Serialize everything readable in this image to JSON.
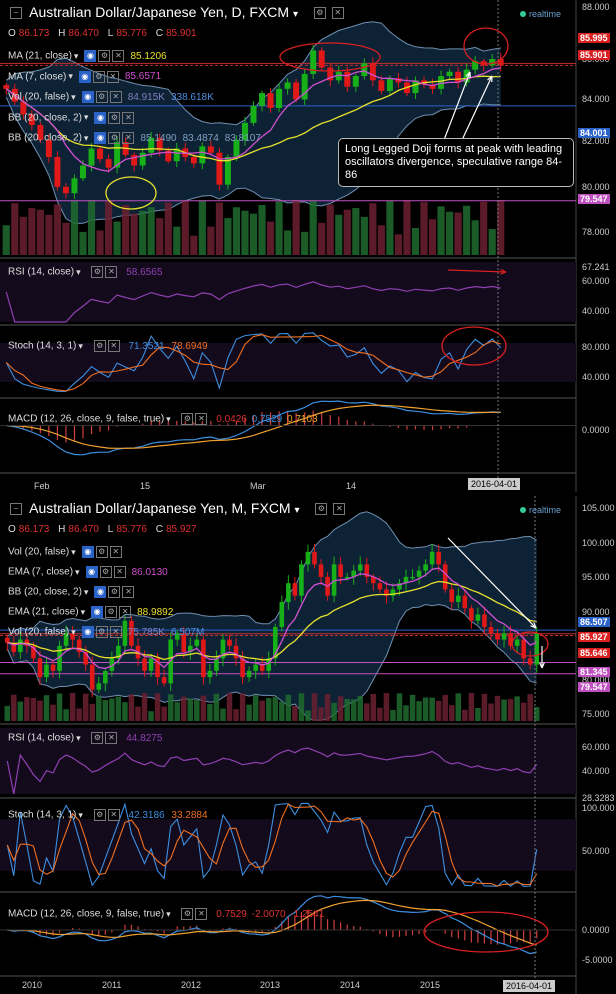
{
  "top": {
    "title": "Australian Dollar/Japanese Yen, D, FXCM",
    "realtime": "realtime",
    "ohlc": {
      "o": "86.173",
      "h": "86.470",
      "l": "85.776",
      "c": "85.901"
    },
    "indicators": [
      {
        "label": "MA (21, close)",
        "values": [
          "85.1206"
        ],
        "colors": [
          "#e8e02c"
        ]
      },
      {
        "label": "MA (7, close)",
        "values": [
          "85.6571"
        ],
        "colors": [
          "#d050d0"
        ]
      },
      {
        "label": "Vol (20, false)",
        "values": [
          "84.915K",
          "338.618K"
        ],
        "colors": [
          "#8080c0",
          "#4f8fe0"
        ]
      },
      {
        "label": "BB (20, close, 2)",
        "values": [],
        "colors": []
      },
      {
        "label": "BB (20, close, 2)",
        "values": [
          "85.1490",
          "83.4874",
          "83.8107"
        ],
        "colors": [
          "#7fa0c0",
          "#7fa0c0",
          "#7fa0c0"
        ]
      }
    ],
    "price_axis": [
      "88.000",
      "86.000",
      "84.000",
      "82.000",
      "80.000",
      "78.000"
    ],
    "tags": [
      {
        "text": "85.995",
        "color": "#d82020"
      },
      {
        "text": "85.901",
        "color": "#d82020"
      },
      {
        "text": "84.001",
        "color": "#2a62c8"
      },
      {
        "text": "79.547",
        "color": "#c050c0"
      }
    ],
    "annotation": "Long Legged Doji forms at peak with leading oscillators divergence, speculative range 84-86",
    "rsi": {
      "label": "RSI (14, close)",
      "value": "58.6565",
      "axis": [
        "67.241",
        "60.000",
        "40.000"
      ]
    },
    "stoch": {
      "label": "Stoch (14, 3, 1)",
      "values": [
        "71.3521",
        "78.6949"
      ],
      "axis": [
        "80.000",
        "40.000"
      ]
    },
    "macd": {
      "label": "MACD (12, 26, close, 9, false, true)",
      "values": [
        "0.0426",
        "0.7529",
        "0.7103"
      ],
      "axis": [
        "0.0000"
      ]
    },
    "x_labels": [
      "Feb",
      "15",
      "Mar",
      "14"
    ],
    "date_box": "2016-04-01"
  },
  "bottom": {
    "title": "Australian Dollar/Japanese Yen, M, FXCM",
    "realtime": "realtime",
    "ohlc": {
      "o": "86.173",
      "h": "86.470",
      "l": "85.776",
      "c": "85.927"
    },
    "indicators": [
      {
        "label": "Vol (20, false)",
        "values": [],
        "colors": []
      },
      {
        "label": "EMA (7, close)",
        "values": [
          "86.0130"
        ],
        "colors": [
          "#d050d0"
        ]
      },
      {
        "label": "BB (20, close, 2)",
        "values": [],
        "colors": []
      },
      {
        "label": "EMA (21, close)",
        "values": [
          "88.9892"
        ],
        "colors": [
          "#e8e02c"
        ]
      },
      {
        "label": "Vol (20, false)",
        "values": [
          "75.785K",
          "6.507M"
        ],
        "colors": [
          "#8080c0",
          "#4f8fe0"
        ]
      }
    ],
    "price_axis": [
      "105.000",
      "100.000",
      "95.000",
      "90.000",
      "80.000",
      "75.000"
    ],
    "tags": [
      {
        "text": "86.507",
        "color": "#2a62c8"
      },
      {
        "text": "85.927",
        "color": "#d82020"
      },
      {
        "text": "85.646",
        "color": "#d82020"
      },
      {
        "text": "81.345",
        "color": "#c050c0"
      },
      {
        "text": "79.547",
        "color": "#c050c0"
      }
    ],
    "rsi": {
      "label": "RSI (14, close)",
      "value": "44.8275",
      "axis": [
        "60.000",
        "40.000",
        "28.3283"
      ]
    },
    "stoch": {
      "label": "Stoch (14, 3, 1)",
      "values": [
        "42.3186",
        "33.2884"
      ],
      "axis": [
        "100.000",
        "50.000"
      ]
    },
    "macd": {
      "label": "MACD (12, 26, close, 9, false, true)",
      "values": [
        "0.7529",
        "-2.0070",
        "-1.2541"
      ],
      "axis": [
        "0.0000",
        "-5.0000"
      ]
    },
    "x_labels": [
      "2010",
      "2011",
      "2012",
      "2013",
      "2014",
      "2015"
    ],
    "date_box": "2016-04-01"
  },
  "colors": {
    "up": "#18b018",
    "down": "#e01818",
    "ema_fast": "#d050d0",
    "ema_slow": "#e8e02c",
    "bb": "#6f8fb0",
    "rsi": "#9040b0",
    "stoch_k": "#3d8fe0",
    "stoch_d": "#f07020",
    "macd": "#3d8fe0",
    "signal": "#f0a030"
  },
  "chart_data": [
    {
      "type": "candlestick",
      "title": "Australian Dollar/Japanese Yen, D, FXCM",
      "ylim": [
        77,
        88.5
      ],
      "close": [
        84.8,
        84.2,
        83.6,
        83.1,
        82.4,
        81.6,
        80.2,
        79.9,
        80.6,
        81.2,
        82.0,
        81.5,
        81.1,
        82.3,
        81.7,
        81.2,
        81.8,
        82.5,
        81.9,
        81.4,
        82.0,
        81.6,
        81.3,
        82.1,
        81.8,
        80.3,
        81.6,
        82.4,
        83.2,
        84.0,
        84.6,
        83.9,
        84.8,
        85.1,
        84.3,
        85.5,
        86.6,
        85.8,
        85.2,
        85.6,
        84.9,
        85.4,
        86.0,
        85.2,
        84.7,
        85.3,
        85.1,
        84.6,
        85.2,
        85.0,
        84.8,
        85.4,
        85.6,
        85.1,
        85.7,
        86.1,
        85.9,
        86.2,
        85.901
      ]
    },
    {
      "type": "candlestick",
      "title": "Australian Dollar/Japanese Yen, M, FXCM",
      "ylim": [
        72,
        106
      ],
      "close": [
        84.5,
        83,
        85,
        84,
        82,
        79,
        81,
        80,
        84,
        86,
        85,
        83,
        81,
        77,
        78,
        80,
        82,
        84,
        88,
        84,
        82,
        80,
        82,
        79,
        78,
        85,
        86,
        83,
        84,
        85,
        79,
        80,
        82,
        85,
        84,
        82,
        79,
        80,
        81,
        80,
        82,
        87,
        91,
        94,
        92,
        97,
        99,
        97,
        95,
        92,
        97,
        95,
        95,
        96,
        97,
        95,
        94,
        93,
        92,
        93,
        94,
        95,
        95,
        96,
        97,
        99,
        97,
        93,
        91,
        92,
        90,
        88,
        89,
        87,
        86,
        85,
        86,
        84,
        85,
        82,
        81,
        85.927
      ]
    }
  ]
}
